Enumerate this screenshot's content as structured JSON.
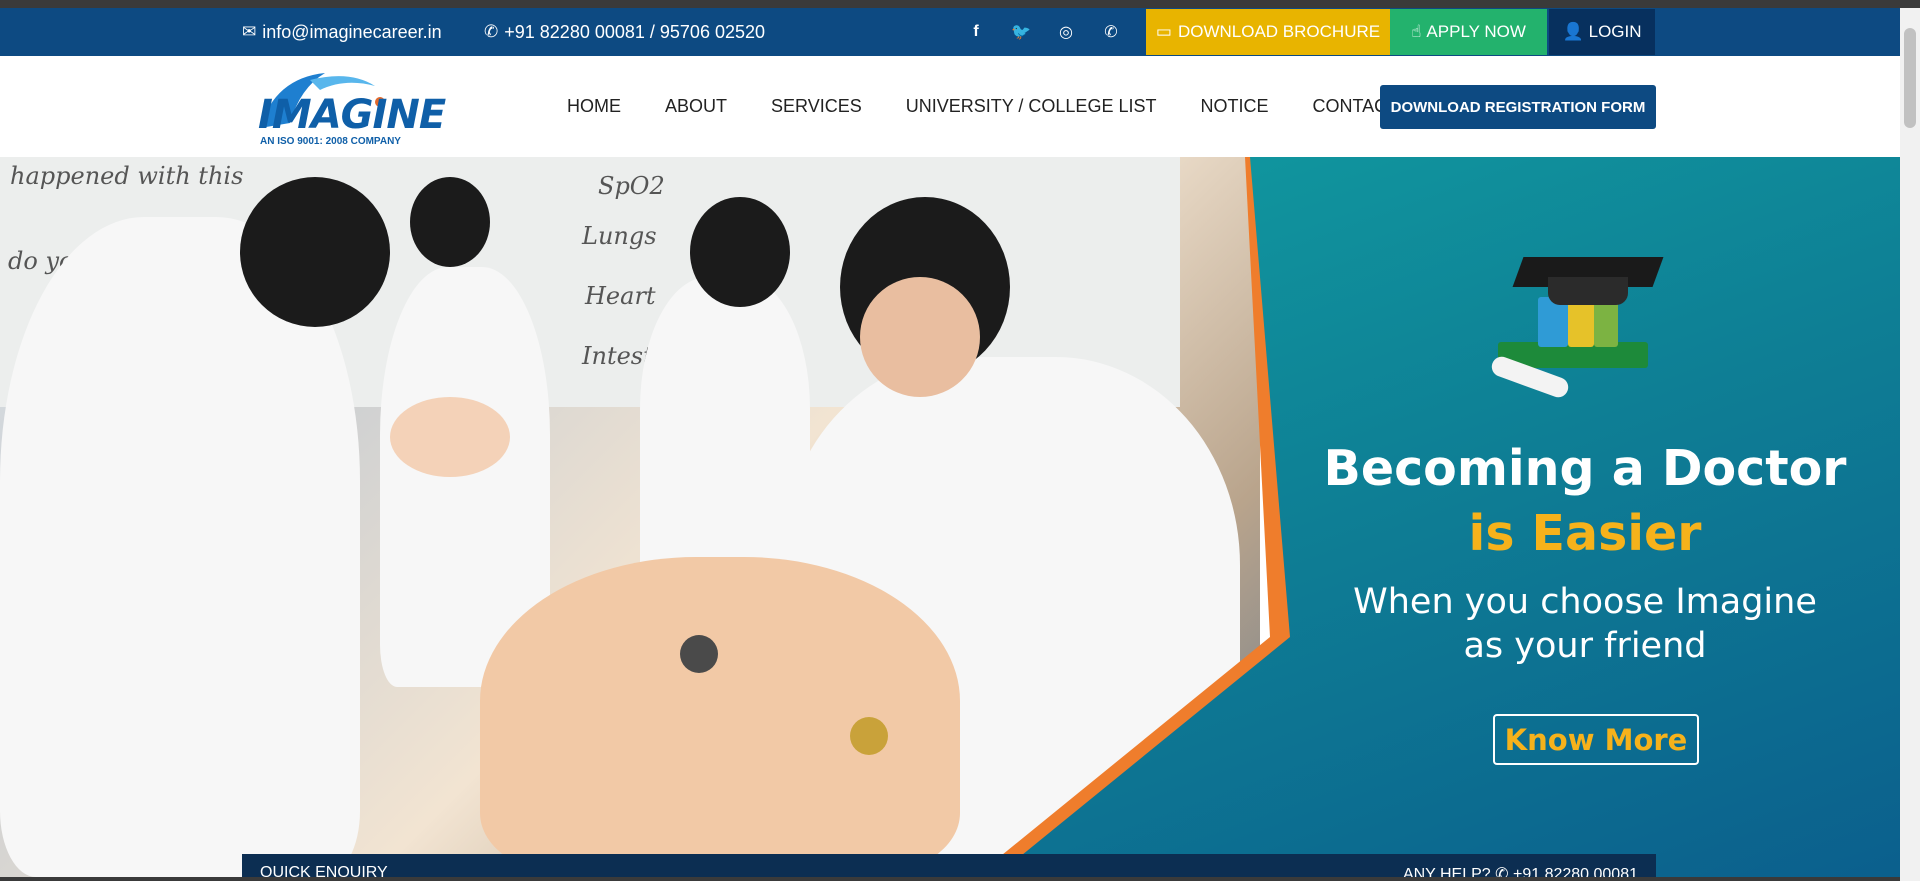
{
  "topbar": {
    "email": "info@imaginecareer.in",
    "phone": "+91 82280 00081 / 95706 02520",
    "social": [
      "f",
      "t",
      "ig",
      "wa"
    ],
    "brochure_label": "DOWNLOAD BROCHURE",
    "apply_label": "APPLY NOW",
    "login_label": "LOGIN"
  },
  "brand": {
    "name": "IMAGINE",
    "tagline": "AN ISO 9001: 2008 COMPANY"
  },
  "nav": {
    "items": [
      "HOME",
      "ABOUT",
      "SERVICES",
      "UNIVERSITY / COLLEGE LIST",
      "NOTICE",
      "CONTACT"
    ],
    "register_label": "DOWNLOAD REGISTRATION FORM"
  },
  "hero": {
    "whiteboard": [
      "happened with this",
      "SpO2",
      "Lungs",
      "Heart",
      "Intestine",
      "do you"
    ],
    "headline_1": "Becoming a Doctor",
    "headline_2": "is Easier",
    "sub_1": "When you choose Imagine",
    "sub_2": "as your friend",
    "cta": "Know More"
  },
  "enquiry": {
    "left": "QUICK ENQUIRY",
    "right": "ANY HELP? ✆ +91 82280 00081"
  },
  "colors": {
    "primary": "#0d4a82",
    "brochure": "#e8b400",
    "apply": "#23b26d",
    "login": "#07305e",
    "accent": "#f6b21b",
    "orange": "#ef7d2c"
  },
  "icons": {
    "email": "mail-icon",
    "phone": "phone-icon",
    "brochure": "download-icon",
    "apply": "hand-pointer-icon",
    "login": "user-icon"
  }
}
